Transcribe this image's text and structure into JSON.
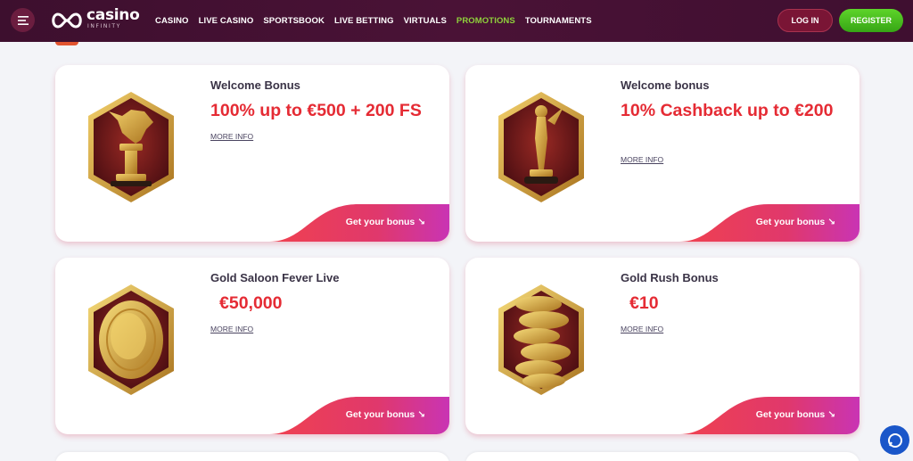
{
  "header": {
    "logo_text": "casino",
    "logo_sub": "INFINITY",
    "nav": [
      {
        "label": "CASINO",
        "active": false
      },
      {
        "label": "LIVE CASINO",
        "active": false
      },
      {
        "label": "SPORTSBOOK",
        "active": false
      },
      {
        "label": "LIVE BETTING",
        "active": false
      },
      {
        "label": "VIRTUALS",
        "active": false
      },
      {
        "label": "PROMOTIONS",
        "active": true
      },
      {
        "label": "TOURNAMENTS",
        "active": false
      }
    ],
    "login_label": "LOG IN",
    "register_label": "REGISTER"
  },
  "cards": [
    {
      "title": "Welcome Bonus",
      "amount": "100% up to €500 + 200 FS",
      "more": "MORE INFO",
      "cta": "Get your bonus ↘",
      "image": "winged-lion-statue"
    },
    {
      "title": "Welcome bonus",
      "amount": "10% Cashback up to €200",
      "more": "MORE INFO",
      "cta": "Get your bonus ↘",
      "image": "award-statuette"
    },
    {
      "title": "Gold Saloon Fever Live",
      "amount": "€50,000",
      "more": "MORE INFO",
      "cta": "Get your bonus ↘",
      "image": "gold-coin"
    },
    {
      "title": "Gold Rush Bonus",
      "amount": "€10",
      "more": "MORE INFO",
      "cta": "Get your bonus ↘",
      "image": "gold-coin-stack"
    }
  ],
  "colors": {
    "header_bg": "#3d0f2e",
    "active_nav": "#8fd13c",
    "amount": "#e52b34",
    "register": "#4cc320",
    "chat": "#1a56c9"
  },
  "icons": [
    "menu-icon",
    "infinity-logo-icon",
    "chat-icon"
  ]
}
